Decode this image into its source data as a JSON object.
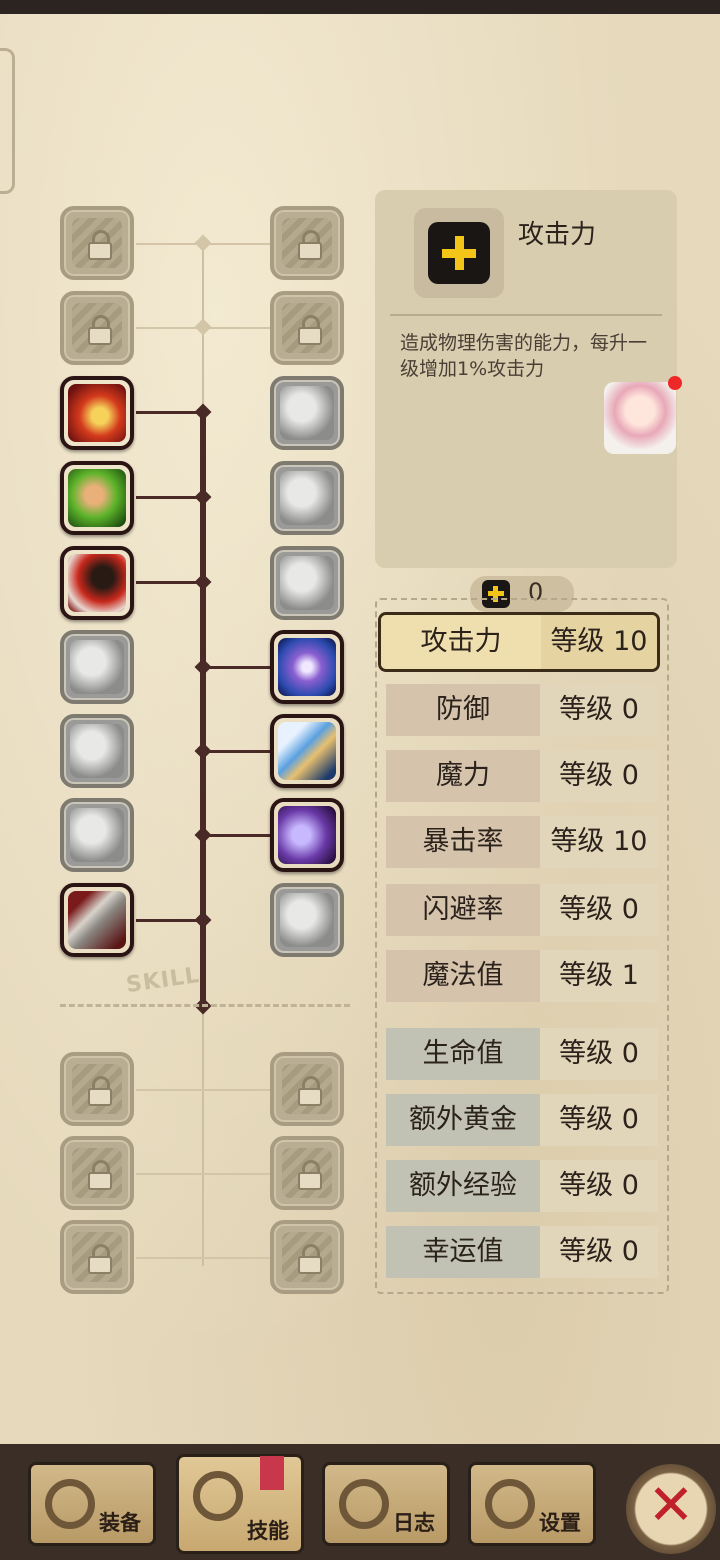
{
  "info": {
    "title": "攻击力",
    "description": "造成物理伤害的能力，每升一级增加1%攻击力"
  },
  "skill_label": "SKILL",
  "points": {
    "value": "0"
  },
  "stats": [
    {
      "name": "攻击力",
      "level": "等级 10"
    },
    {
      "name": "防御",
      "level": "等级 0"
    },
    {
      "name": "魔力",
      "level": "等级 0"
    },
    {
      "name": "暴击率",
      "level": "等级 10"
    },
    {
      "name": "闪避率",
      "level": "等级 0"
    },
    {
      "name": "魔法值",
      "level": "等级 1"
    },
    {
      "name": "生命值",
      "level": "等级 0"
    },
    {
      "name": "额外黄金",
      "level": "等级 0"
    },
    {
      "name": "额外经验",
      "level": "等级 0"
    },
    {
      "name": "幸运值",
      "level": "等级 0"
    }
  ],
  "nav": {
    "equipment": "装备",
    "skills": "技能",
    "log": "日志",
    "settings": "设置"
  },
  "colors": {
    "accent_yellow": "#f2c518",
    "close_red": "#c0202a",
    "dark_line": "#4a2a26"
  }
}
